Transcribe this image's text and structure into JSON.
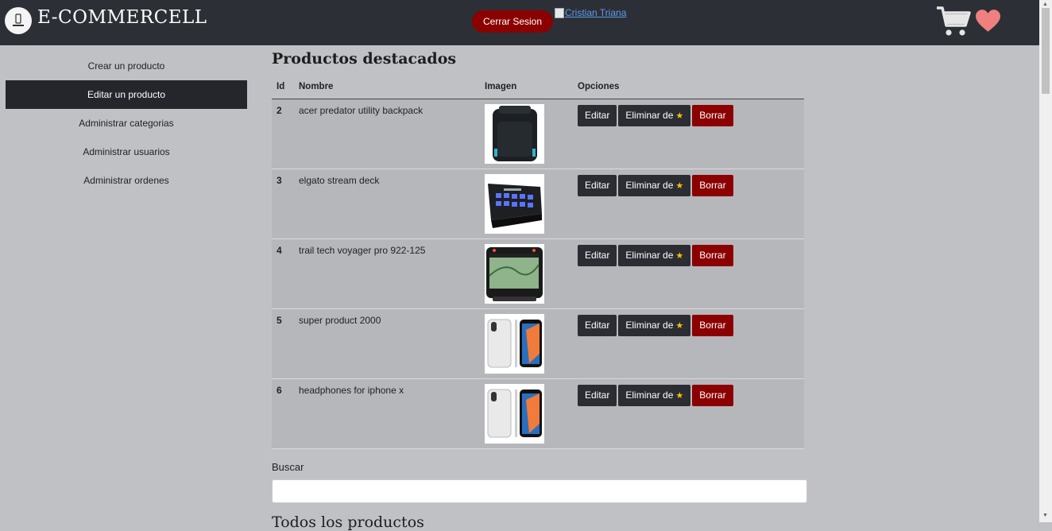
{
  "header": {
    "brand": "E-COMMERCELL",
    "logout_label": "Cerrar Sesion",
    "user_link": "Cristian Triana"
  },
  "sidebar": {
    "items": [
      {
        "label": "Crear un producto"
      },
      {
        "label": "Editar un producto"
      },
      {
        "label": "Administrar categorias"
      },
      {
        "label": "Administrar usuarios"
      },
      {
        "label": "Administrar ordenes"
      }
    ],
    "active_index": 1
  },
  "featured": {
    "title": "Productos destacados",
    "columns": [
      "Id",
      "Nombre",
      "Imagen",
      "Opciones"
    ],
    "rows": [
      {
        "id": "2",
        "name": "acer predator utility backpack",
        "image": "backpack"
      },
      {
        "id": "3",
        "name": "elgato stream deck",
        "image": "stream-deck"
      },
      {
        "id": "4",
        "name": "trail tech voyager pro 922-125",
        "image": "gps-device"
      },
      {
        "id": "5",
        "name": "super product 2000",
        "image": "phone"
      },
      {
        "id": "6",
        "name": "headphones for iphone x",
        "image": "phone"
      }
    ],
    "buttons": {
      "edit": "Editar",
      "remove_featured": "Eliminar de",
      "delete": "Borrar"
    }
  },
  "search": {
    "label": "Buscar",
    "value": "",
    "placeholder": ""
  },
  "all_products_title": "Todos los productos",
  "colors": {
    "header_bg": "#2d2f36",
    "page_bg": "#c0c1c5",
    "danger": "#8b0000",
    "heart": "#f08080"
  }
}
